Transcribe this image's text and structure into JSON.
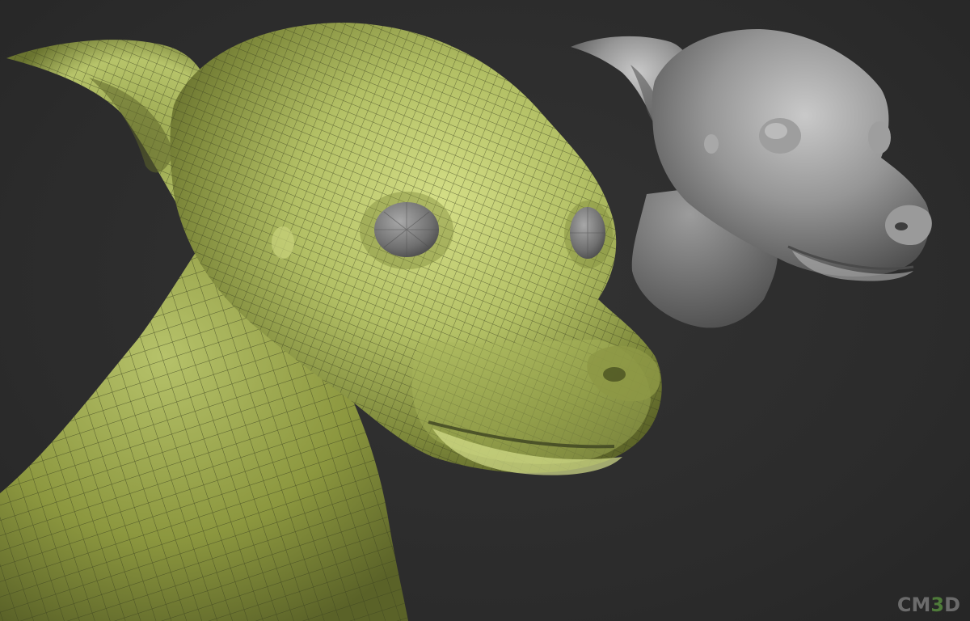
{
  "scene": {
    "background_color": "#2c2c2c",
    "mesh_color": "#b7c46a",
    "mesh_shadow_color": "#6f7a35",
    "wire_color": "#3c4220",
    "eye_color": "#777777",
    "clay_color": "#8d8d8d",
    "clay_highlight": "#c4c4c4",
    "clay_shadow": "#4a4a4a"
  },
  "watermark": {
    "prefix": "CM",
    "accent": "3",
    "suffix": "D",
    "accent_color": "#4f7b3a"
  }
}
